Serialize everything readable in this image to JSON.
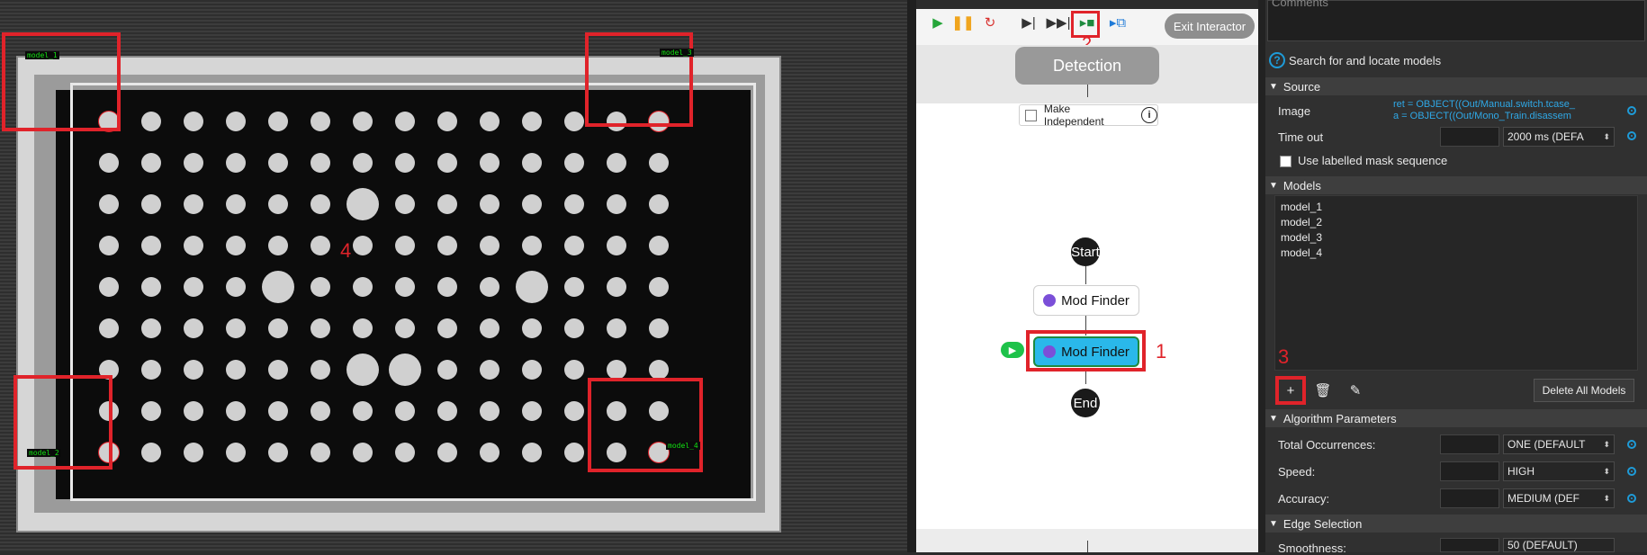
{
  "image_view": {
    "model_tags": [
      "model_1",
      "model_2",
      "model_3",
      "model_4"
    ],
    "markers": {
      "board": "4",
      "flow_node": "1",
      "toolbar": "2",
      "add_model": "3"
    }
  },
  "toolbar": {
    "exit_label": "Exit Interactor",
    "icons": [
      "play-icon",
      "pause-icon",
      "restart-icon",
      "step-icon",
      "fast-forward-icon",
      "run-to-icon",
      "export-icon"
    ]
  },
  "flow": {
    "detection_label": "Detection",
    "make_independent_label": "Make Independent",
    "start_label": "Start",
    "node1_label": "Mod Finder",
    "node2_label": "Mod Finder",
    "end_label": "End"
  },
  "props": {
    "comments_label": "Comments",
    "help_text": "Search for and locate models",
    "source": {
      "header": "Source",
      "image_label": "Image",
      "image_value_line1": "ret = OBJECT((Out/Manual.switch.tcase_",
      "image_value_line2": "a = OBJECT((Out/Mono_Train.disassem",
      "timeout_label": "Time out",
      "timeout_value": "2000 ms (DEFA",
      "use_labelled_label": "Use labelled mask sequence"
    },
    "models": {
      "header": "Models",
      "items": [
        "model_1",
        "model_2",
        "model_3",
        "model_4"
      ],
      "delete_all_label": "Delete All Models"
    },
    "algorithm": {
      "header": "Algorithm Parameters",
      "total_label": "Total Occurrences:",
      "total_value": "ONE (DEFAULT",
      "speed_label": "Speed:",
      "speed_value": "HIGH",
      "accuracy_label": "Accuracy:",
      "accuracy_value": "MEDIUM (DEF"
    },
    "edge": {
      "header": "Edge Selection",
      "smoothness_label": "Smoothness:",
      "smoothness_value": "50 (DEFAULT)"
    }
  }
}
